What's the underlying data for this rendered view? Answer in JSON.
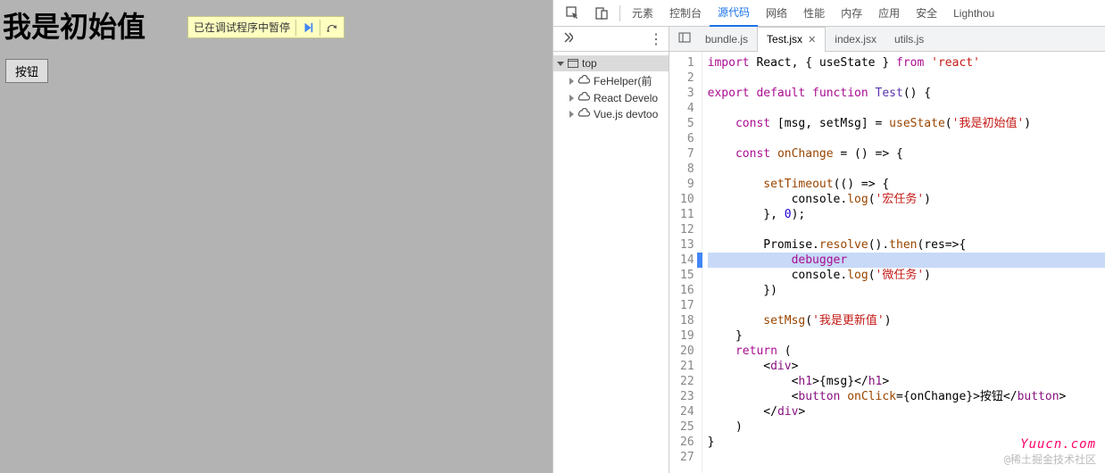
{
  "app": {
    "heading": "我是初始值",
    "button_label": "按钮",
    "pause_text": "已在调试程序中暂停"
  },
  "devtools": {
    "tabs": [
      "元素",
      "控制台",
      "源代码",
      "网络",
      "性能",
      "内存",
      "应用",
      "安全",
      "Lighthou"
    ],
    "active_tab_index": 2,
    "nav": {
      "root": "top",
      "items": [
        "FeHelper(前",
        "React Develo",
        "Vue.js devtoo"
      ]
    },
    "files": {
      "tabs": [
        "bundle.js",
        "Test.jsx",
        "index.jsx",
        "utils.js"
      ],
      "active_index": 1
    },
    "code": {
      "exec_line": 14,
      "lines": [
        {
          "n": 1,
          "segs": [
            [
              "kw",
              "import"
            ],
            [
              "pun",
              " React, { useState } "
            ],
            [
              "kw",
              "from"
            ],
            [
              "pun",
              " "
            ],
            [
              "str",
              "'react'"
            ]
          ]
        },
        {
          "n": 2,
          "segs": []
        },
        {
          "n": 3,
          "segs": [
            [
              "kw",
              "export default function"
            ],
            [
              "pun",
              " "
            ],
            [
              "fn",
              "Test"
            ],
            [
              "pun",
              "() {"
            ]
          ]
        },
        {
          "n": 4,
          "segs": []
        },
        {
          "n": 5,
          "segs": [
            [
              "pun",
              "    "
            ],
            [
              "kw",
              "const"
            ],
            [
              "pun",
              " [msg, setMsg] = "
            ],
            [
              "def",
              "useState"
            ],
            [
              "pun",
              "("
            ],
            [
              "str",
              "'我是初始值'"
            ],
            [
              "pun",
              ")"
            ]
          ]
        },
        {
          "n": 6,
          "segs": []
        },
        {
          "n": 7,
          "segs": [
            [
              "pun",
              "    "
            ],
            [
              "kw",
              "const"
            ],
            [
              "pun",
              " "
            ],
            [
              "def",
              "onChange"
            ],
            [
              "pun",
              " = () => {"
            ]
          ]
        },
        {
          "n": 8,
          "segs": []
        },
        {
          "n": 9,
          "segs": [
            [
              "pun",
              "        "
            ],
            [
              "def",
              "setTimeout"
            ],
            [
              "pun",
              "(() => {"
            ]
          ]
        },
        {
          "n": 10,
          "segs": [
            [
              "pun",
              "            console."
            ],
            [
              "def",
              "log"
            ],
            [
              "pun",
              "("
            ],
            [
              "str",
              "'宏任务'"
            ],
            [
              "pun",
              ")"
            ]
          ]
        },
        {
          "n": 11,
          "segs": [
            [
              "pun",
              "        }, "
            ],
            [
              "num",
              "0"
            ],
            [
              "pun",
              ");"
            ]
          ]
        },
        {
          "n": 12,
          "segs": []
        },
        {
          "n": 13,
          "segs": [
            [
              "pun",
              "        Promise."
            ],
            [
              "def",
              "resolve"
            ],
            [
              "pun",
              "()."
            ],
            [
              "def",
              "then"
            ],
            [
              "pun",
              "(res=>{"
            ]
          ]
        },
        {
          "n": 14,
          "segs": [
            [
              "pun",
              "            "
            ],
            [
              "kw",
              "debugger"
            ]
          ]
        },
        {
          "n": 15,
          "segs": [
            [
              "pun",
              "            console."
            ],
            [
              "def",
              "log"
            ],
            [
              "pun",
              "("
            ],
            [
              "str",
              "'微任务'"
            ],
            [
              "pun",
              ")"
            ]
          ]
        },
        {
          "n": 16,
          "segs": [
            [
              "pun",
              "        })"
            ]
          ]
        },
        {
          "n": 17,
          "segs": []
        },
        {
          "n": 18,
          "segs": [
            [
              "pun",
              "        "
            ],
            [
              "def",
              "setMsg"
            ],
            [
              "pun",
              "("
            ],
            [
              "str",
              "'我是更新值'"
            ],
            [
              "pun",
              ")"
            ]
          ]
        },
        {
          "n": 19,
          "segs": [
            [
              "pun",
              "    }"
            ]
          ]
        },
        {
          "n": 20,
          "segs": [
            [
              "pun",
              "    "
            ],
            [
              "kw",
              "return"
            ],
            [
              "pun",
              " ("
            ]
          ]
        },
        {
          "n": 21,
          "segs": [
            [
              "pun",
              "        <"
            ],
            [
              "tag",
              "div"
            ],
            [
              "pun",
              ">"
            ]
          ]
        },
        {
          "n": 22,
          "segs": [
            [
              "pun",
              "            <"
            ],
            [
              "tag",
              "h1"
            ],
            [
              "pun",
              ">{msg}</"
            ],
            [
              "tag",
              "h1"
            ],
            [
              "pun",
              ">"
            ]
          ]
        },
        {
          "n": 23,
          "segs": [
            [
              "pun",
              "            <"
            ],
            [
              "tag",
              "button"
            ],
            [
              "pun",
              " "
            ],
            [
              "attr",
              "onClick"
            ],
            [
              "pun",
              "={onChange}>按钮</"
            ],
            [
              "tag",
              "button"
            ],
            [
              "pun",
              ">"
            ]
          ]
        },
        {
          "n": 24,
          "segs": [
            [
              "pun",
              "        </"
            ],
            [
              "tag",
              "div"
            ],
            [
              "pun",
              ">"
            ]
          ]
        },
        {
          "n": 25,
          "segs": [
            [
              "pun",
              "    )"
            ]
          ]
        },
        {
          "n": 26,
          "segs": [
            [
              "pun",
              "}"
            ]
          ]
        },
        {
          "n": 27,
          "segs": []
        }
      ]
    }
  },
  "watermark": {
    "brand": "Yuucn.com",
    "text": "@稀土掘金技术社区"
  }
}
